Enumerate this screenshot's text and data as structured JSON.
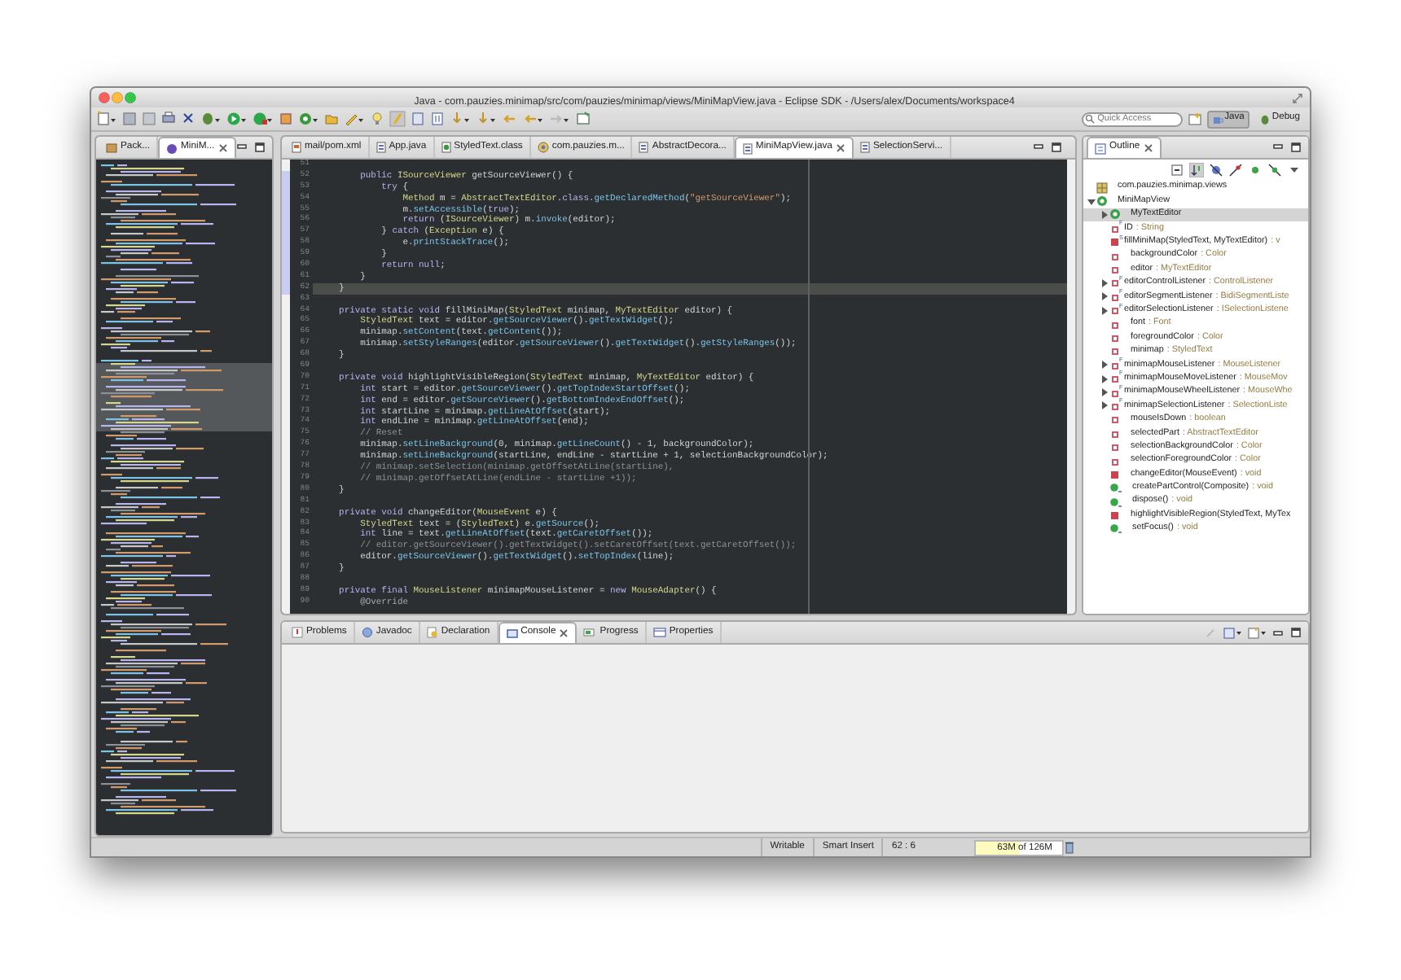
{
  "window": {
    "title": "Java - com.pauzies.minimap/src/com/pauzies/minimap/views/MiniMapView.java - Eclipse SDK - /Users/alex/Documents/workspace4"
  },
  "toolbar": {
    "quick_access": {
      "placeholder": "Quick Access"
    },
    "perspectives": [
      {
        "label": "Java",
        "selected": true
      },
      {
        "label": "Debug",
        "selected": false
      }
    ]
  },
  "left_panel": {
    "tabs": [
      {
        "label": "Pack...",
        "kind": "package",
        "selected": false
      },
      {
        "label": "MiniM...",
        "kind": "view",
        "selected": true
      }
    ]
  },
  "editor": {
    "tabs": [
      {
        "label": "mail/pom.xml",
        "kind": "xml",
        "selected": false
      },
      {
        "label": "App.java",
        "kind": "java",
        "selected": false
      },
      {
        "label": "StyledText.class",
        "kind": "class",
        "selected": false
      },
      {
        "label": "com.pauzies.m...",
        "kind": "plugin",
        "selected": false
      },
      {
        "label": "AbstractDecora...",
        "kind": "java",
        "selected": false
      },
      {
        "label": "MiniMapView.java",
        "kind": "java",
        "selected": true
      },
      {
        "label": "SelectionServi...",
        "kind": "java",
        "selected": false
      }
    ],
    "lines": [
      {
        "number": "51",
        "changed": false,
        "current": false
      },
      {
        "number": "52",
        "changed": true,
        "current": false,
        "tokens": [
          {
            "kind": "kw",
            "text": "        public "
          },
          {
            "kind": "type",
            "text": "ISourceViewer"
          },
          {
            "kind": "text",
            "text": " getSourceViewer() {"
          }
        ]
      },
      {
        "number": "53",
        "changed": true,
        "current": false,
        "tokens": [
          {
            "kind": "kw",
            "text": "            try"
          },
          {
            "kind": "text",
            "text": " {"
          }
        ]
      },
      {
        "number": "54",
        "changed": true,
        "current": false,
        "tokens": [
          {
            "kind": "type",
            "text": "                Method"
          },
          {
            "kind": "text",
            "text": " m = "
          },
          {
            "kind": "type",
            "text": "AbstractTextEditor"
          },
          {
            "kind": "text",
            "text": "."
          },
          {
            "kind": "kw",
            "text": "class"
          },
          {
            "kind": "text",
            "text": "."
          },
          {
            "kind": "call",
            "text": "getDeclaredMethod"
          },
          {
            "kind": "text",
            "text": "("
          },
          {
            "kind": "str",
            "text": "\"getSourceViewer\""
          },
          {
            "kind": "text",
            "text": ");"
          }
        ]
      },
      {
        "number": "55",
        "changed": true,
        "current": false,
        "tokens": [
          {
            "kind": "text",
            "text": "                m."
          },
          {
            "kind": "call",
            "text": "setAccessible"
          },
          {
            "kind": "text",
            "text": "("
          },
          {
            "kind": "kw",
            "text": "true"
          },
          {
            "kind": "text",
            "text": ");"
          }
        ]
      },
      {
        "number": "56",
        "changed": true,
        "current": false,
        "tokens": [
          {
            "kind": "kw",
            "text": "                return"
          },
          {
            "kind": "text",
            "text": " ("
          },
          {
            "kind": "type",
            "text": "ISourceViewer"
          },
          {
            "kind": "text",
            "text": ") m."
          },
          {
            "kind": "call",
            "text": "invoke"
          },
          {
            "kind": "text",
            "text": "(editor);"
          }
        ]
      },
      {
        "number": "57",
        "changed": true,
        "current": false,
        "tokens": [
          {
            "kind": "text",
            "text": "            } "
          },
          {
            "kind": "kw",
            "text": "catch"
          },
          {
            "kind": "text",
            "text": " ("
          },
          {
            "kind": "type",
            "text": "Exception"
          },
          {
            "kind": "text",
            "text": " e) {"
          }
        ]
      },
      {
        "number": "58",
        "changed": true,
        "current": false,
        "tokens": [
          {
            "kind": "text",
            "text": "                e."
          },
          {
            "kind": "call",
            "text": "printStackTrace"
          },
          {
            "kind": "text",
            "text": "();"
          }
        ]
      },
      {
        "number": "59",
        "changed": true,
        "current": false,
        "tokens": [
          {
            "kind": "text",
            "text": "            }"
          }
        ]
      },
      {
        "number": "60",
        "changed": true,
        "current": false,
        "tokens": [
          {
            "kind": "kw",
            "text": "            return null"
          },
          {
            "kind": "text",
            "text": ";"
          }
        ]
      },
      {
        "number": "61",
        "changed": true,
        "current": false,
        "tokens": [
          {
            "kind": "text",
            "text": "        }"
          }
        ]
      },
      {
        "number": "62",
        "changed": true,
        "current": true,
        "tokens": [
          {
            "kind": "text",
            "text": "    }"
          }
        ]
      },
      {
        "number": "63",
        "changed": false,
        "current": false
      },
      {
        "number": "64",
        "changed": false,
        "current": false,
        "tokens": [
          {
            "kind": "kw",
            "text": "    private static void"
          },
          {
            "kind": "text",
            "text": " fillMiniMap("
          },
          {
            "kind": "type",
            "text": "StyledText"
          },
          {
            "kind": "text",
            "text": " minimap, "
          },
          {
            "kind": "type",
            "text": "MyTextEditor"
          },
          {
            "kind": "text",
            "text": " editor) {"
          }
        ]
      },
      {
        "number": "65",
        "changed": false,
        "current": false,
        "tokens": [
          {
            "kind": "type",
            "text": "        StyledText"
          },
          {
            "kind": "text",
            "text": " text = editor."
          },
          {
            "kind": "call",
            "text": "getSourceViewer"
          },
          {
            "kind": "text",
            "text": "()."
          },
          {
            "kind": "call",
            "text": "getTextWidget"
          },
          {
            "kind": "text",
            "text": "();"
          }
        ]
      },
      {
        "number": "66",
        "changed": false,
        "current": false,
        "tokens": [
          {
            "kind": "text",
            "text": "        minimap."
          },
          {
            "kind": "call",
            "text": "setContent"
          },
          {
            "kind": "text",
            "text": "(text."
          },
          {
            "kind": "call",
            "text": "getContent"
          },
          {
            "kind": "text",
            "text": "());"
          }
        ]
      },
      {
        "number": "67",
        "changed": false,
        "current": false,
        "tokens": [
          {
            "kind": "text",
            "text": "        minimap."
          },
          {
            "kind": "call",
            "text": "setStyleRanges"
          },
          {
            "kind": "text",
            "text": "(editor."
          },
          {
            "kind": "call",
            "text": "getSourceViewer"
          },
          {
            "kind": "text",
            "text": "()."
          },
          {
            "kind": "call",
            "text": "getTextWidget"
          },
          {
            "kind": "text",
            "text": "()."
          },
          {
            "kind": "call",
            "text": "getStyleRanges"
          },
          {
            "kind": "text",
            "text": "());"
          }
        ]
      },
      {
        "number": "68",
        "changed": false,
        "current": false,
        "tokens": [
          {
            "kind": "text",
            "text": "    }"
          }
        ]
      },
      {
        "number": "69",
        "changed": false,
        "current": false
      },
      {
        "number": "70",
        "changed": false,
        "current": false,
        "tokens": [
          {
            "kind": "kw",
            "text": "    private void"
          },
          {
            "kind": "text",
            "text": " highlightVisibleRegion("
          },
          {
            "kind": "type",
            "text": "StyledText"
          },
          {
            "kind": "text",
            "text": " minimap, "
          },
          {
            "kind": "type",
            "text": "MyTextEditor"
          },
          {
            "kind": "text",
            "text": " editor) {"
          }
        ]
      },
      {
        "number": "71",
        "changed": false,
        "current": false,
        "tokens": [
          {
            "kind": "kw",
            "text": "        int"
          },
          {
            "kind": "text",
            "text": " start = editor."
          },
          {
            "kind": "call",
            "text": "getSourceViewer"
          },
          {
            "kind": "text",
            "text": "()."
          },
          {
            "kind": "call",
            "text": "getTopIndexStartOffset"
          },
          {
            "kind": "text",
            "text": "();"
          }
        ]
      },
      {
        "number": "72",
        "changed": false,
        "current": false,
        "tokens": [
          {
            "kind": "kw",
            "text": "        int"
          },
          {
            "kind": "text",
            "text": " end = editor."
          },
          {
            "kind": "call",
            "text": "getSourceViewer"
          },
          {
            "kind": "text",
            "text": "()."
          },
          {
            "kind": "call",
            "text": "getBottomIndexEndOffset"
          },
          {
            "kind": "text",
            "text": "();"
          }
        ]
      },
      {
        "number": "73",
        "changed": false,
        "current": false,
        "tokens": [
          {
            "kind": "kw",
            "text": "        int"
          },
          {
            "kind": "text",
            "text": " startLine = minimap."
          },
          {
            "kind": "call",
            "text": "getLineAtOffset"
          },
          {
            "kind": "text",
            "text": "(start);"
          }
        ]
      },
      {
        "number": "74",
        "changed": false,
        "current": false,
        "tokens": [
          {
            "kind": "kw",
            "text": "        int"
          },
          {
            "kind": "text",
            "text": " endLine = minimap."
          },
          {
            "kind": "call",
            "text": "getLineAtOffset"
          },
          {
            "kind": "text",
            "text": "(end);"
          }
        ]
      },
      {
        "number": "75",
        "changed": false,
        "current": false,
        "tokens": [
          {
            "kind": "comment",
            "text": "        // Reset"
          }
        ]
      },
      {
        "number": "76",
        "changed": false,
        "current": false,
        "tokens": [
          {
            "kind": "text",
            "text": "        minimap."
          },
          {
            "kind": "call",
            "text": "setLineBackground"
          },
          {
            "kind": "text",
            "text": "(0, minimap."
          },
          {
            "kind": "call",
            "text": "getLineCount"
          },
          {
            "kind": "text",
            "text": "() - 1, backgroundColor);"
          }
        ]
      },
      {
        "number": "77",
        "changed": false,
        "current": false,
        "tokens": [
          {
            "kind": "text",
            "text": "        minimap."
          },
          {
            "kind": "call",
            "text": "setLineBackground"
          },
          {
            "kind": "text",
            "text": "(startLine, endLine - startLine + 1, selectionBackgroundColor);"
          }
        ]
      },
      {
        "number": "78",
        "changed": false,
        "current": false,
        "tokens": [
          {
            "kind": "comment",
            "text": "        // minimap.setSelection(minimap.getOffsetAtLine(startLine),"
          }
        ]
      },
      {
        "number": "79",
        "changed": false,
        "current": false,
        "tokens": [
          {
            "kind": "comment",
            "text": "        // minimap.getOffsetAtLine(endLine - startLine +1));"
          }
        ]
      },
      {
        "number": "80",
        "changed": false,
        "current": false,
        "tokens": [
          {
            "kind": "text",
            "text": "    }"
          }
        ]
      },
      {
        "number": "81",
        "changed": false,
        "current": false
      },
      {
        "number": "82",
        "changed": false,
        "current": false,
        "tokens": [
          {
            "kind": "kw",
            "text": "    private void"
          },
          {
            "kind": "text",
            "text": " changeEditor("
          },
          {
            "kind": "type",
            "text": "MouseEvent"
          },
          {
            "kind": "text",
            "text": " e) {"
          }
        ]
      },
      {
        "number": "83",
        "changed": false,
        "current": false,
        "tokens": [
          {
            "kind": "type",
            "text": "        StyledText"
          },
          {
            "kind": "text",
            "text": " text = ("
          },
          {
            "kind": "type",
            "text": "StyledText"
          },
          {
            "kind": "text",
            "text": ") e."
          },
          {
            "kind": "call",
            "text": "getSource"
          },
          {
            "kind": "text",
            "text": "();"
          }
        ]
      },
      {
        "number": "84",
        "changed": false,
        "current": false,
        "tokens": [
          {
            "kind": "kw",
            "text": "        int"
          },
          {
            "kind": "text",
            "text": " line = text."
          },
          {
            "kind": "call",
            "text": "getLineAtOffset"
          },
          {
            "kind": "text",
            "text": "(text."
          },
          {
            "kind": "call",
            "text": "getCaretOffset"
          },
          {
            "kind": "text",
            "text": "());"
          }
        ]
      },
      {
        "number": "85",
        "changed": false,
        "current": false,
        "tokens": [
          {
            "kind": "comment",
            "text": "        // editor.getSourceViewer().getTextWidget().setCaretOffset(text.getCaretOffset());"
          }
        ]
      },
      {
        "number": "86",
        "changed": false,
        "current": false,
        "tokens": [
          {
            "kind": "text",
            "text": "        editor."
          },
          {
            "kind": "call",
            "text": "getSourceViewer"
          },
          {
            "kind": "text",
            "text": "()."
          },
          {
            "kind": "call",
            "text": "getTextWidget"
          },
          {
            "kind": "text",
            "text": "()."
          },
          {
            "kind": "call",
            "text": "setTopIndex"
          },
          {
            "kind": "text",
            "text": "(line);"
          }
        ]
      },
      {
        "number": "87",
        "changed": false,
        "current": false,
        "tokens": [
          {
            "kind": "text",
            "text": "    }"
          }
        ]
      },
      {
        "number": "88",
        "changed": false,
        "current": false
      },
      {
        "number": "89",
        "changed": false,
        "current": false,
        "tokens": [
          {
            "kind": "kw",
            "text": "    private final "
          },
          {
            "kind": "type",
            "text": "MouseListener"
          },
          {
            "kind": "text",
            "text": " minimapMouseListener = "
          },
          {
            "kind": "kw",
            "text": "new "
          },
          {
            "kind": "type",
            "text": "MouseAdapter"
          },
          {
            "kind": "text",
            "text": "() {"
          }
        ]
      },
      {
        "number": "90",
        "changed": false,
        "current": false,
        "tokens": [
          {
            "kind": "annotation",
            "text": "        @Override"
          }
        ]
      }
    ]
  },
  "outline": {
    "tabs": [
      {
        "label": "Outline",
        "selected": true
      }
    ],
    "tree": [
      {
        "kind": "package",
        "name": "com.pauzies.minimap.views",
        "selected": false
      },
      {
        "kind": "class",
        "name": "MiniMapView",
        "selected": false,
        "expanded": true,
        "children": [
          {
            "kind": "inner-class",
            "name": "MyTextEditor",
            "selected": true,
            "expanded": false
          },
          {
            "kind": "field",
            "name": "ID",
            "type": ": String",
            "overlay": "F",
            "selected": false
          },
          {
            "kind": "private-method",
            "name": "fillMiniMap(StyledText, MyTextEditor)",
            "type": ": v",
            "overlay": "S",
            "selected": false
          },
          {
            "kind": "field",
            "name": "backgroundColor",
            "type": ": Color",
            "selected": false
          },
          {
            "kind": "field",
            "name": "editor",
            "type": ": MyTextEditor",
            "selected": false
          },
          {
            "kind": "field",
            "name": "editorControlListener",
            "type": ": ControlListener",
            "overlay": "F",
            "selected": false,
            "expanded": false
          },
          {
            "kind": "field",
            "name": "editorSegmentListener",
            "type": ": BidiSegmentListe",
            "overlay": "F",
            "selected": false,
            "expanded": false
          },
          {
            "kind": "field",
            "name": "editorSelectionListener",
            "type": ": ISelectionListene",
            "overlay": "F",
            "selected": false,
            "expanded": false
          },
          {
            "kind": "field",
            "name": "font",
            "type": ": Font",
            "selected": false
          },
          {
            "kind": "field",
            "name": "foregroundColor",
            "type": ": Color",
            "selected": false
          },
          {
            "kind": "field",
            "name": "minimap",
            "type": ": StyledText",
            "selected": false
          },
          {
            "kind": "field",
            "name": "minimapMouseListener",
            "type": ": MouseListener",
            "overlay": "F",
            "selected": false,
            "expanded": false
          },
          {
            "kind": "field",
            "name": "minimapMouseMoveListener",
            "type": ": MouseMov",
            "overlay": "F",
            "selected": false,
            "expanded": false
          },
          {
            "kind": "field",
            "name": "minimapMouseWheelListener",
            "type": ": MouseWhe",
            "overlay": "F",
            "selected": false,
            "expanded": false
          },
          {
            "kind": "field",
            "name": "minimapSelectionListener",
            "type": ": SelectionListe",
            "overlay": "F",
            "selected": false,
            "expanded": false
          },
          {
            "kind": "field",
            "name": "mouseIsDown",
            "type": ": boolean",
            "selected": false
          },
          {
            "kind": "field",
            "name": "selectedPart",
            "type": ": AbstractTextEditor",
            "selected": false
          },
          {
            "kind": "field",
            "name": "selectionBackgroundColor",
            "type": ": Color",
            "selected": false
          },
          {
            "kind": "field",
            "name": "selectionForegroundColor",
            "type": ": Color",
            "selected": false
          },
          {
            "kind": "private-method",
            "name": "changeEditor(MouseEvent)",
            "type": ": void",
            "selected": false
          },
          {
            "kind": "public-method",
            "name": "createPartControl(Composite)",
            "type": ": void",
            "selected": false
          },
          {
            "kind": "public-method",
            "name": "dispose()",
            "type": ": void",
            "selected": false
          },
          {
            "kind": "private-method",
            "name": "highlightVisibleRegion(StyledText, MyTex",
            "selected": false
          },
          {
            "kind": "public-method",
            "name": "setFocus()",
            "type": ": void",
            "selected": false
          }
        ]
      }
    ]
  },
  "bottom_panel": {
    "tabs": [
      {
        "label": "Problems",
        "kind": "problems",
        "selected": false
      },
      {
        "label": "Javadoc",
        "kind": "javadoc",
        "selected": false
      },
      {
        "label": "Declaration",
        "kind": "declaration",
        "selected": false
      },
      {
        "label": "Console",
        "kind": "console",
        "selected": true
      },
      {
        "label": "Progress",
        "kind": "progress",
        "selected": false
      },
      {
        "label": "Properties",
        "kind": "properties",
        "selected": false
      }
    ]
  },
  "status_bar": {
    "mode": "Writable",
    "insert_mode": "Smart Insert",
    "position": "62 : 6",
    "heap": {
      "text": "63M of 126M",
      "level": 0.5
    }
  }
}
